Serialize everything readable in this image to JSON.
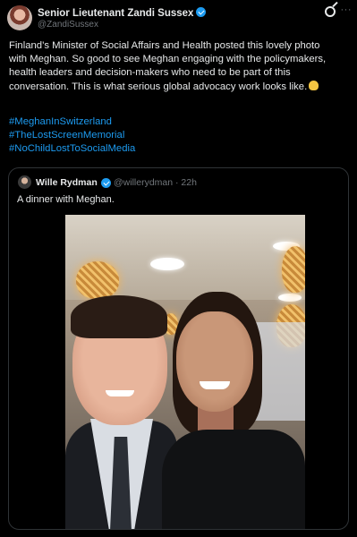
{
  "post": {
    "author_name": "Senior Lieutenant Zandi Sussex",
    "author_handle": "@ZandiSussex",
    "text_lines": [
      "Finland’s Minister of Social Affairs and Health posted this lovely photo",
      "with Meghan. So good to see Meghan engaging with the policymakers,",
      "health leaders and decision-makers who need to be part of this",
      "conversation. This is what serious global advocacy work looks like."
    ],
    "hashtags": [
      "#MeghanInSwitzerland",
      "#TheLostScreenMemorial",
      "#NoChildLostToSocialMedia"
    ],
    "more_label": "···"
  },
  "quoted": {
    "author_name": "Wille Rydman",
    "author_handle": "@willerydman · 22h",
    "text": "A dinner with Meghan."
  },
  "colors": {
    "background": "#000000",
    "link": "#1d9bf0",
    "verified": "#1d9bf0",
    "muted": "#71767b"
  }
}
